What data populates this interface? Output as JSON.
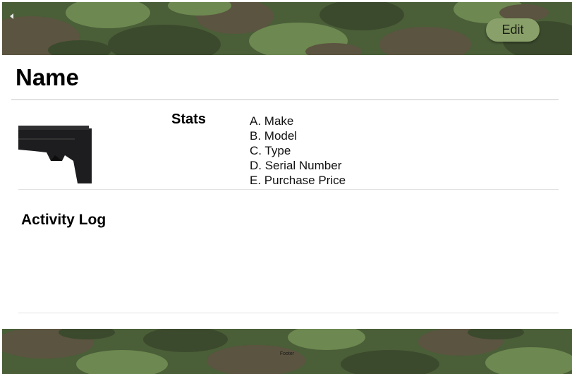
{
  "header": {
    "back_icon": "triangle-left-icon",
    "edit_label": "Edit",
    "edit_color": "#8aa06a"
  },
  "page": {
    "title": "Name"
  },
  "stats": {
    "heading": "Stats",
    "items": [
      "A. Make",
      "B. Model",
      "C. Type",
      "D. Serial Number",
      "E. Purchase Price"
    ]
  },
  "activity": {
    "heading": "Activity Log"
  },
  "footer": {
    "text": "Footer"
  },
  "theme": {
    "camo_base": "#4a5e38",
    "camo_dark": "#3b4a2d",
    "camo_light": "#6d8850",
    "camo_brown": "#5b5440"
  }
}
